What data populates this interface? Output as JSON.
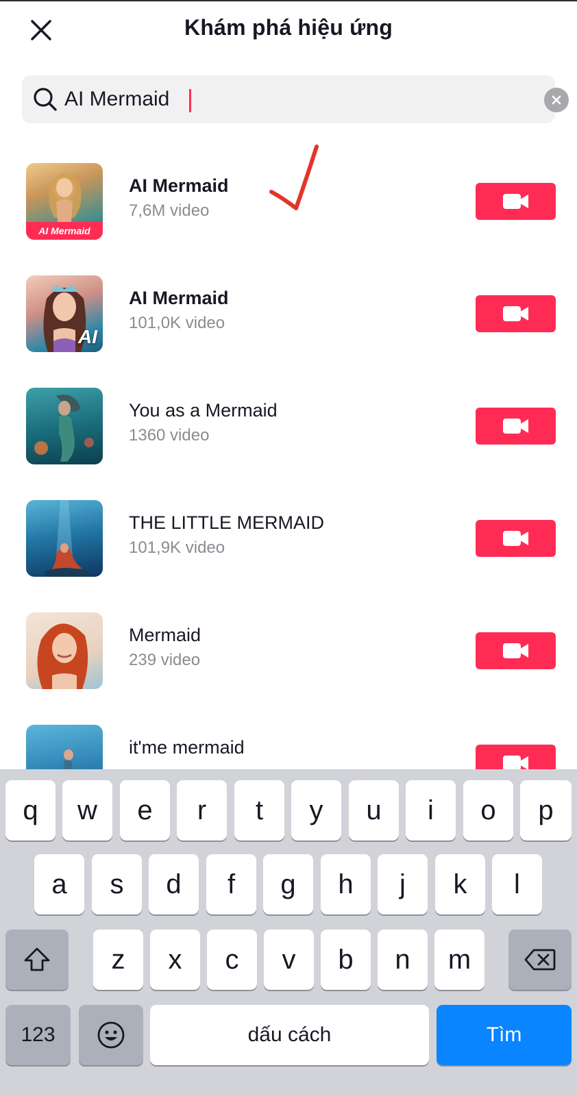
{
  "header": {
    "title": "Khám phá hiệu ứng"
  },
  "search": {
    "value": "AI Mermaid"
  },
  "results": [
    {
      "name": "AI Mermaid",
      "count": "7,6M video",
      "bold": true,
      "thumb_tag": "AI Mermaid",
      "colors": [
        "#e8b86a",
        "#3d8a8c"
      ]
    },
    {
      "name": "AI Mermaid",
      "count": "101,0K video",
      "bold": true,
      "thumb_tag": "AI",
      "colors": [
        "#e6a89a",
        "#2a7e98"
      ]
    },
    {
      "name": "You as a Mermaid",
      "count": "1360 video",
      "bold": false,
      "colors": [
        "#1c7c8c",
        "#0d4a5a"
      ]
    },
    {
      "name": "THE LITTLE MERMAID",
      "count": "101,9K video",
      "bold": false,
      "colors": [
        "#2a86b8",
        "#0c3d66"
      ]
    },
    {
      "name": "Mermaid",
      "count": "239 video",
      "bold": false,
      "colors": [
        "#d2582e",
        "#f3d9c8"
      ]
    },
    {
      "name": "it'me mermaid",
      "count": "",
      "bold": false,
      "colors": [
        "#3a9bc6",
        "#1a5a82"
      ]
    }
  ],
  "keyboard": {
    "row1": [
      "q",
      "w",
      "e",
      "r",
      "t",
      "y",
      "u",
      "i",
      "o",
      "p"
    ],
    "row2": [
      "a",
      "s",
      "d",
      "f",
      "g",
      "h",
      "j",
      "k",
      "l"
    ],
    "row3": [
      "z",
      "x",
      "c",
      "v",
      "b",
      "n",
      "m"
    ],
    "numbers_label": "123",
    "space_label": "dấu cách",
    "search_label": "Tìm"
  },
  "colors": {
    "accent": "#fe2c55",
    "keyboard_bg": "#d1d3d9",
    "search_key": "#0a84ff"
  }
}
